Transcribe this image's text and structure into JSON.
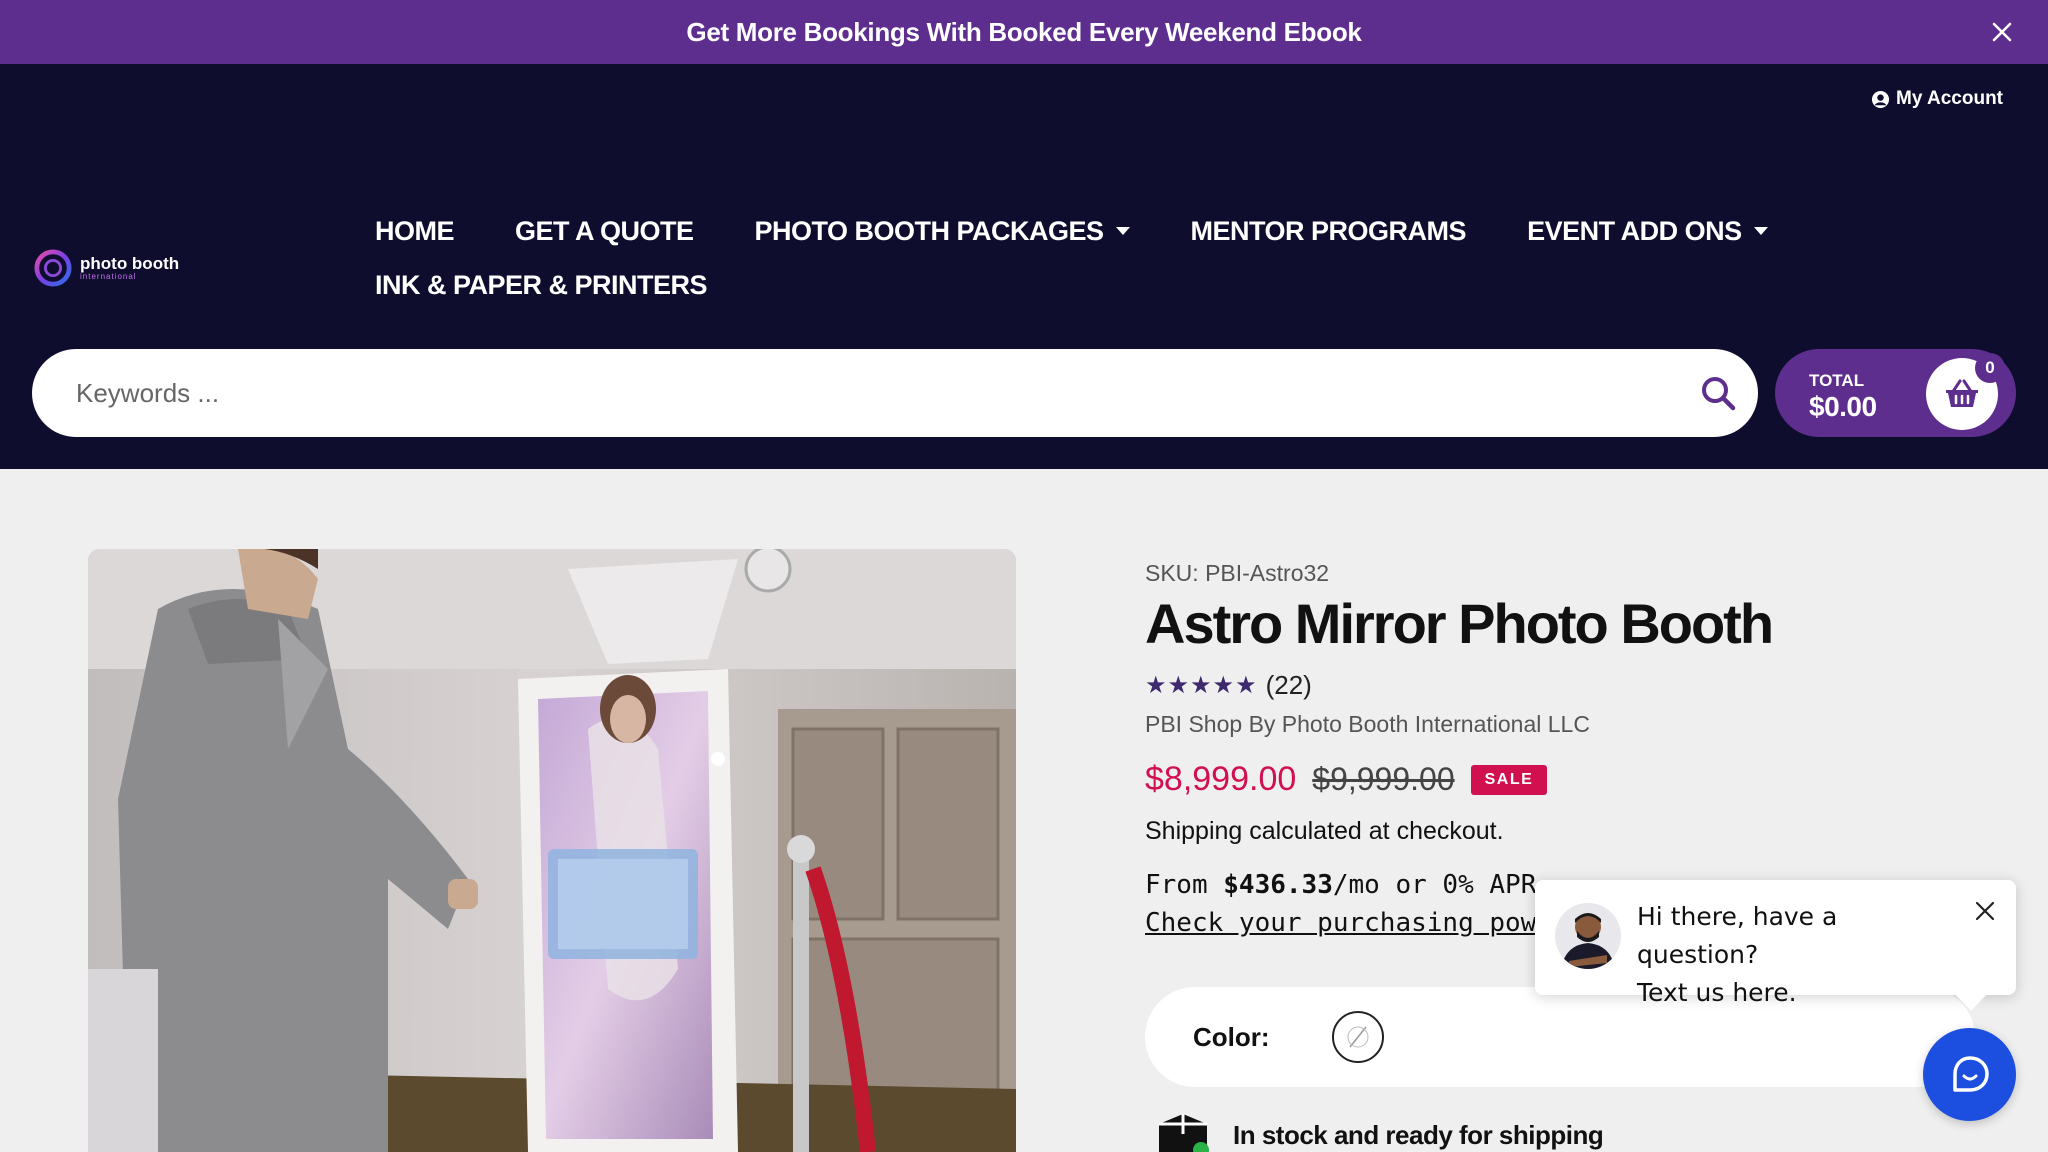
{
  "promo_bar": {
    "text": "Get More Bookings With Booked Every Weekend Ebook",
    "close_icon": "close-icon"
  },
  "header": {
    "account_label": "My Account",
    "logo": {
      "name": "photo booth",
      "tagline": "international"
    },
    "nav": [
      {
        "label": "HOME",
        "has_dropdown": false
      },
      {
        "label": "GET A QUOTE",
        "has_dropdown": false
      },
      {
        "label": "PHOTO BOOTH PACKAGES",
        "has_dropdown": true
      },
      {
        "label": "MENTOR PROGRAMS",
        "has_dropdown": false
      },
      {
        "label": "EVENT ADD ONS",
        "has_dropdown": true
      },
      {
        "label": "INK & PAPER & PRINTERS",
        "has_dropdown": false
      }
    ],
    "search": {
      "placeholder": "Keywords ...",
      "value": ""
    },
    "cart": {
      "total_label": "TOTAL",
      "total_value": "$0.00",
      "count": "0"
    }
  },
  "product": {
    "sku": "SKU: PBI-Astro32",
    "title": "Astro Mirror Photo Booth",
    "stars": "★★★★★",
    "rating": 5,
    "review_count": "(22)",
    "vendor": "PBI Shop By Photo Booth International LLC",
    "price": "$8,999.00",
    "compare_price": "$9,999.00",
    "badge": "SALE",
    "shipping": "Shipping calculated at checkout.",
    "financing": {
      "prefix": "From ",
      "amount": "$436.33",
      "suffix": "/mo or 0% APR",
      "link": "Check your purchasing power"
    },
    "color_label": "Color:",
    "stock": "In stock and ready for shipping"
  },
  "chat": {
    "message_line1": "Hi there, have a question?",
    "message_line2": "Text us here."
  },
  "colors": {
    "brand_purple": "#5e2e8e",
    "header_navy": "#0f0d2e",
    "sale_red": "#d1104f",
    "chat_blue": "#1c4fe0"
  }
}
